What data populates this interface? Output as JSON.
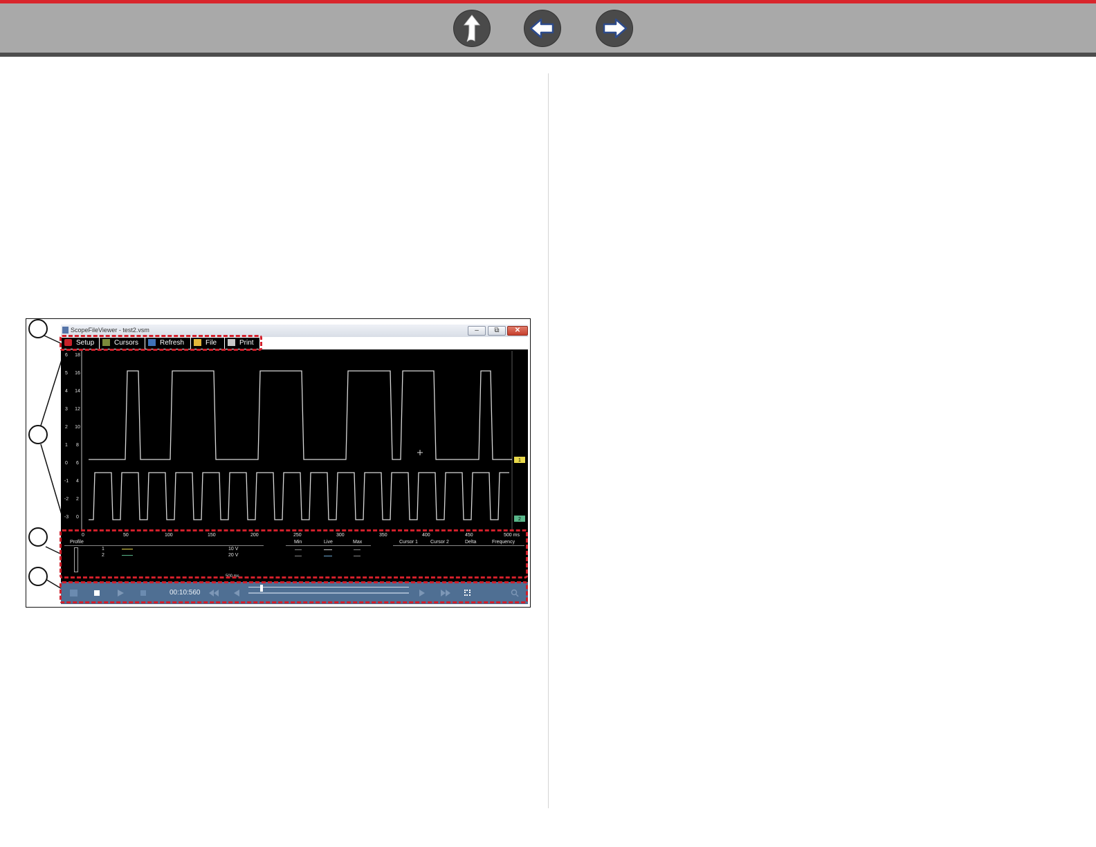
{
  "nav": {
    "up_icon": "up-arrow-icon",
    "back_icon": "left-arrow-icon",
    "forward_icon": "right-arrow-icon",
    "accent_color": "#d9262c"
  },
  "window": {
    "title": "ScopeFileViewer - test2.vsm",
    "minimize": "–",
    "restore": "⧉",
    "close": "✕"
  },
  "toolbar": {
    "setup": "Setup",
    "cursors": "Cursors",
    "refresh": "Refresh",
    "file": "File",
    "print": "Print"
  },
  "plot": {
    "y_left_outer": [
      "6",
      "5",
      "4",
      "3",
      "2",
      "1",
      "0",
      "-1",
      "-2",
      "-3"
    ],
    "y_left_inner": [
      "18",
      "16",
      "14",
      "12",
      "10",
      "8",
      "6",
      "4",
      "2",
      "0"
    ],
    "x_ticks": [
      "0",
      "50",
      "100",
      "150",
      "200",
      "250",
      "300",
      "350",
      "400",
      "450",
      "500 ms"
    ],
    "channel_1_marker": "1",
    "channel_2_marker": "2",
    "channel_1_color": "#e8d84a",
    "channel_2_color": "#59b68a"
  },
  "table": {
    "profile_header": "Profile",
    "min_header": "Min",
    "live_header": "Live",
    "max_header": "Max",
    "cursor1_header": "Cursor 1",
    "cursor2_header": "Cursor 2",
    "delta_header": "Delta",
    "frequency_header": "Frequency",
    "rows": [
      {
        "num": "1",
        "scale": "10 V"
      },
      {
        "num": "2",
        "scale": "20 V"
      }
    ],
    "timebase": "500 ms"
  },
  "controls": {
    "time": "00:10:560"
  }
}
